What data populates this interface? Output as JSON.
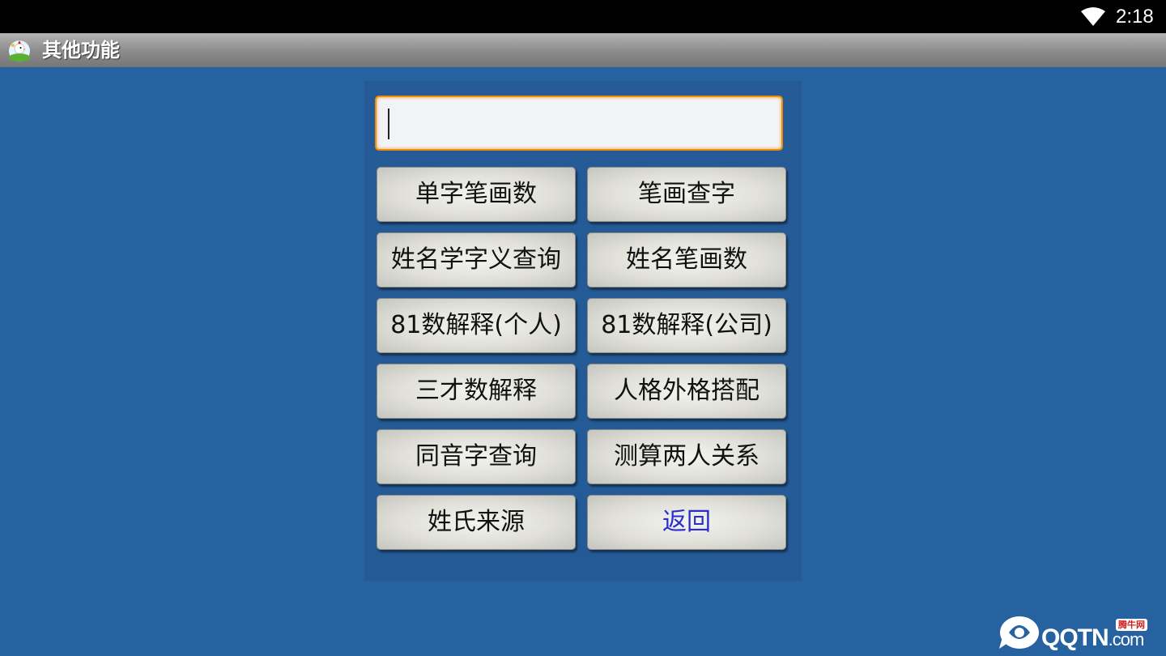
{
  "status_bar": {
    "time": "2:18",
    "wifi_icon": "wifi-icon"
  },
  "title_bar": {
    "app_icon": "app-logo-icon",
    "title": "其他功能"
  },
  "search": {
    "value": "",
    "placeholder": ""
  },
  "buttons": {
    "single_char_strokes": "单字笔画数",
    "strokes_lookup_char": "笔画查字",
    "name_char_meaning": "姓名学字义查询",
    "name_strokes": "姓名笔画数",
    "num81_personal": "81数解释(个人)",
    "num81_company": "81数解释(公司)",
    "sancai": "三才数解释",
    "personality_match": "人格外格搭配",
    "homophone": "同音字查询",
    "relationship": "测算两人关系",
    "surname_origin": "姓氏来源",
    "back": "返回"
  },
  "colors": {
    "background": "#2661a0",
    "panel": "#245a95",
    "input_border": "#f08a0a",
    "back_text": "#2b2bd0"
  },
  "watermark": {
    "text": "QQTN",
    "domain": ".com",
    "badge": "腾牛网"
  }
}
